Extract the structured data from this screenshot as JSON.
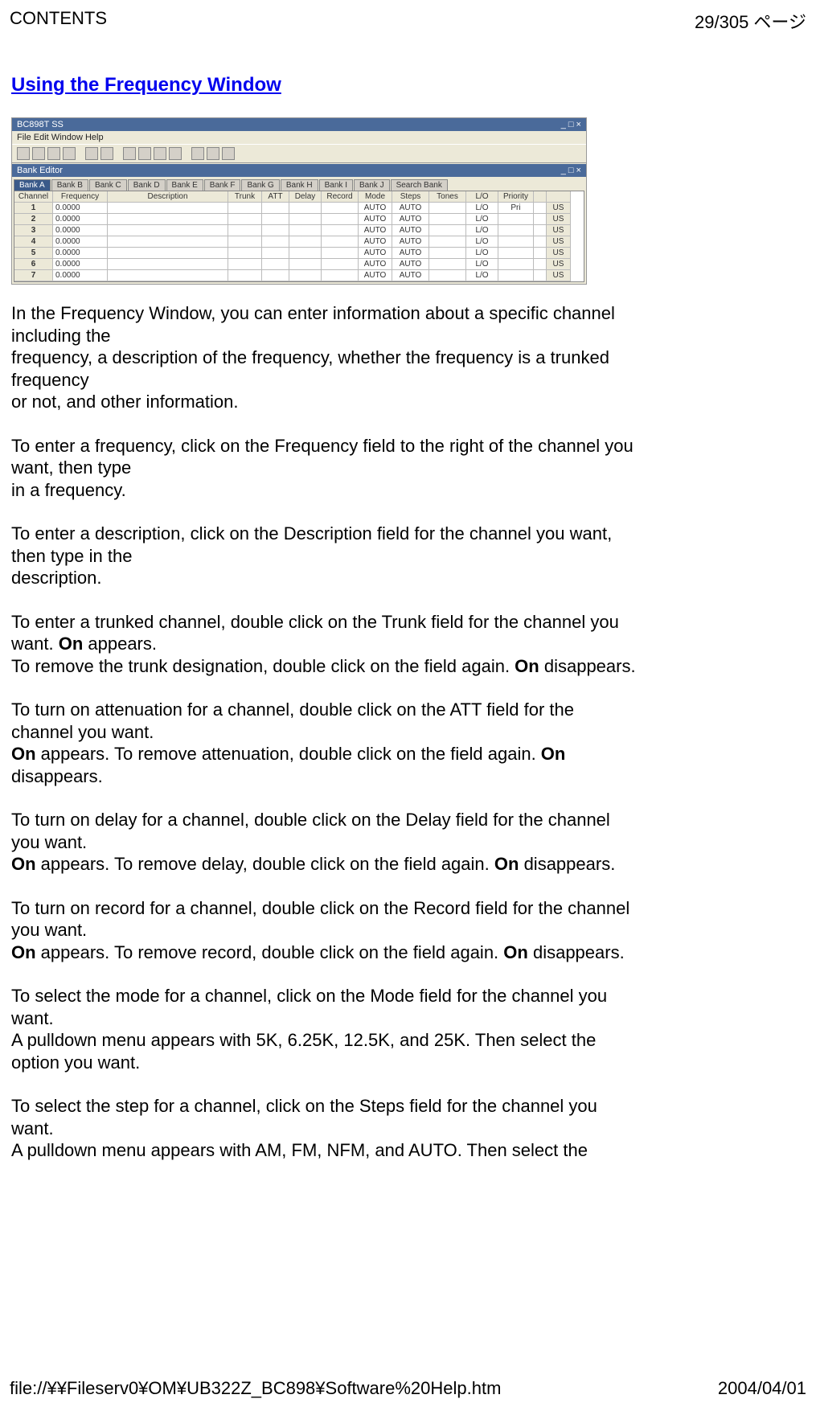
{
  "header": {
    "left": "CONTENTS",
    "right": "29/305 ページ"
  },
  "title": "Using the Frequency Window",
  "screenshot": {
    "app_title": "BC898T SS",
    "menu": "File  Edit  Window  Help",
    "subwindow_title": "Bank Editor",
    "tabs": [
      "Bank A",
      "Bank B",
      "Bank C",
      "Bank D",
      "Bank E",
      "Bank F",
      "Bank G",
      "Bank H",
      "Bank I",
      "Bank J",
      "Search Bank"
    ],
    "columns": [
      "Channel",
      "Frequency",
      "Description",
      "Trunk",
      "ATT",
      "Delay",
      "Record",
      "Mode",
      "Steps",
      "Tones",
      "L/O",
      "Priority"
    ],
    "rows": [
      {
        "ch": "1",
        "fr": "0.0000",
        "de": "",
        "tr": "",
        "at": "",
        "dl": "",
        "rc": "",
        "mo": "AUTO",
        "st": "AUTO",
        "to": "",
        "lo": "L/O",
        "pr": "Pri",
        "en": "US"
      },
      {
        "ch": "2",
        "fr": "0.0000",
        "de": "",
        "tr": "",
        "at": "",
        "dl": "",
        "rc": "",
        "mo": "AUTO",
        "st": "AUTO",
        "to": "",
        "lo": "L/O",
        "pr": "",
        "en": "US"
      },
      {
        "ch": "3",
        "fr": "0.0000",
        "de": "",
        "tr": "",
        "at": "",
        "dl": "",
        "rc": "",
        "mo": "AUTO",
        "st": "AUTO",
        "to": "",
        "lo": "L/O",
        "pr": "",
        "en": "US"
      },
      {
        "ch": "4",
        "fr": "0.0000",
        "de": "",
        "tr": "",
        "at": "",
        "dl": "",
        "rc": "",
        "mo": "AUTO",
        "st": "AUTO",
        "to": "",
        "lo": "L/O",
        "pr": "",
        "en": "US"
      },
      {
        "ch": "5",
        "fr": "0.0000",
        "de": "",
        "tr": "",
        "at": "",
        "dl": "",
        "rc": "",
        "mo": "AUTO",
        "st": "AUTO",
        "to": "",
        "lo": "L/O",
        "pr": "",
        "en": "US"
      },
      {
        "ch": "6",
        "fr": "0.0000",
        "de": "",
        "tr": "",
        "at": "",
        "dl": "",
        "rc": "",
        "mo": "AUTO",
        "st": "AUTO",
        "to": "",
        "lo": "L/O",
        "pr": "",
        "en": "US"
      },
      {
        "ch": "7",
        "fr": "0.0000",
        "de": "",
        "tr": "",
        "at": "",
        "dl": "",
        "rc": "",
        "mo": "AUTO",
        "st": "AUTO",
        "to": "",
        "lo": "L/O",
        "pr": "",
        "en": "US"
      }
    ]
  },
  "body": {
    "p1a": "In the Frequency Window, you can enter information about a specific channel including the",
    "p1b": "frequency, a description of the frequency, whether the frequency is a trunked frequency",
    "p1c": "or not, and other information.",
    "p2a": "To enter a frequency, click on the Frequency field to the right of the channel you want, then type",
    "p2b": "in a frequency.",
    "p3a": "To enter a description, click on the Description field for the channel you want, then type in the",
    "p3b": "description.",
    "p4a": "To enter a trunked channel, double click on the Trunk field for the channel you want. ",
    "p4b": "On",
    "p4c": " appears.",
    "p4d": "To remove the trunk designation, double click on the field again. ",
    "p4e": "On",
    "p4f": " disappears.",
    "p5a": "To turn on attenuation for a channel, double click on the ATT field for the channel you want.",
    "p5b": "On",
    "p5c": " appears. To remove attenuation, double click on the field again. ",
    "p5d": "On",
    "p5e": " disappears.",
    "p6a": "To turn on delay for a channel, double click on the Delay field for the channel you want.",
    "p6b": "On",
    "p6c": " appears. To remove delay, double click on the field again. ",
    "p6d": "On",
    "p6e": " disappears.",
    "p7a": "To turn on record for a channel, double click on the Record field for the channel you want.",
    "p7b": "On",
    "p7c": " appears. To remove record, double click on the field again. ",
    "p7d": "On",
    "p7e": " disappears.",
    "p8a": "To select the mode for a channel, click on the Mode field for the channel you want.",
    "p8b": "A pulldown menu appears with 5K, 6.25K, 12.5K, and 25K. Then select the option you want.",
    "p9a": "To select the step for a channel, click on the Steps field for the channel you want.",
    "p9b": "A pulldown menu appears with AM, FM, NFM, and AUTO. Then select the"
  },
  "footer": {
    "left": "file://¥¥Fileserv0¥OM¥UB322Z_BC898¥Software%20Help.htm",
    "right": "2004/04/01"
  }
}
